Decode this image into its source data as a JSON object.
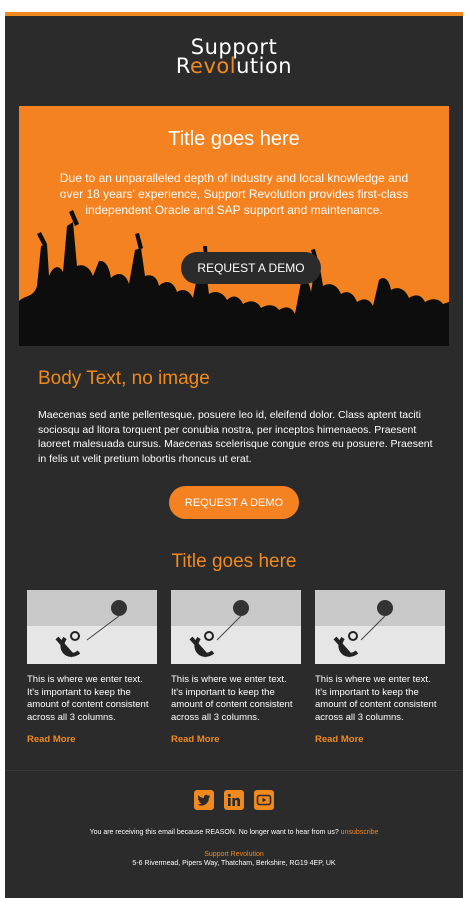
{
  "colors": {
    "accent": "#f08a1f",
    "background": "#2b2b2b",
    "hero_background": "#f58220",
    "text": "#ffffff"
  },
  "logo": {
    "line1": "Support",
    "line2_prefix": "R",
    "line2_accent": "evol",
    "line2_suffix": "ution"
  },
  "hero": {
    "title": "Title goes here",
    "text": "Due to an unparalleled depth of industry and local knowledge and over 18 years' experience, Support Revolution provides first-class independent Oracle and SAP support and maintenance.",
    "button_label": "REQUEST A DEMO"
  },
  "body": {
    "title": "Body Text, no image",
    "text": "Maecenas sed ante pellentesque, posuere leo id, eleifend dolor. Class aptent taciti sociosqu ad litora torquent per conubia nostra, per inceptos himenaeos. Praesent laoreet malesuada cursus. Maecenas scelerisque congue eros eu posuere. Praesent in felis ut velit pretium lobortis rhoncus ut erat.",
    "button_label": "REQUEST A DEMO"
  },
  "section": {
    "title": "Title goes here"
  },
  "columns": [
    {
      "text": "This is where we enter text. It's important to keep the amount of content consistent across all 3 columns.",
      "link": "Read More",
      "image_icon": "anchor-balloon-image"
    },
    {
      "text": "This is where we enter text. It's important to keep the amount of content consistent across all 3 columns.",
      "link": "Read More",
      "image_icon": "anchor-balloon-image"
    },
    {
      "text": "This is where we enter text. It's important to keep the amount of content consistent across all 3 columns.",
      "link": "Read More",
      "image_icon": "anchor-balloon-image"
    }
  ],
  "social": [
    "twitter-icon",
    "linkedin-icon",
    "youtube-icon"
  ],
  "footer": {
    "notice": "You are receiving this email because REASON. No longer want to hear from us?",
    "unsubscribe": "unsubscribe",
    "company": "Support Revolution",
    "address": "5-6 Rivermead, Pipers Way, Thatcham, Berkshire, RG19 4EP, UK"
  }
}
